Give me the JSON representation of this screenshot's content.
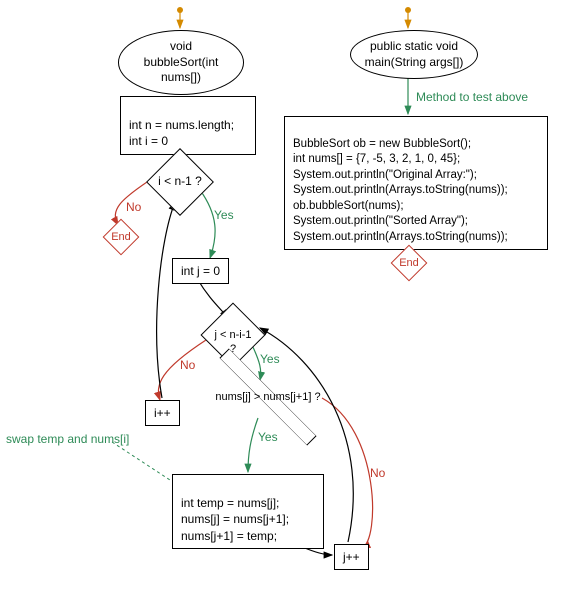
{
  "left": {
    "entry": "void bubbleSort(int nums[])",
    "init": "int n = nums.length;\nint i = 0",
    "cond_i": "i < n-1 ?",
    "yes": "Yes",
    "no": "No",
    "end": "End",
    "init_j": "int j = 0",
    "cond_j": "j < n-i-1 ?",
    "cond_swap": "nums[j] > nums[j+1] ?",
    "inc_i": "i++",
    "swap": "int temp = nums[j];\nnums[j] = nums[j+1];\nnums[j+1] = temp;",
    "inc_j": "j++",
    "swap_comment": "swap temp and nums[i]"
  },
  "right": {
    "entry": "public static void main(String args[])",
    "method_comment": "Method to test above",
    "body": "BubbleSort ob = new BubbleSort();\nint nums[] = {7, -5, 3, 2, 1, 0, 45};\nSystem.out.println(\"Original Array:\");\nSystem.out.println(Arrays.toString(nums));\nob.bubbleSort(nums);\nSystem.out.println(\"Sorted Array\");\nSystem.out.println(Arrays.toString(nums));",
    "end": "End"
  }
}
